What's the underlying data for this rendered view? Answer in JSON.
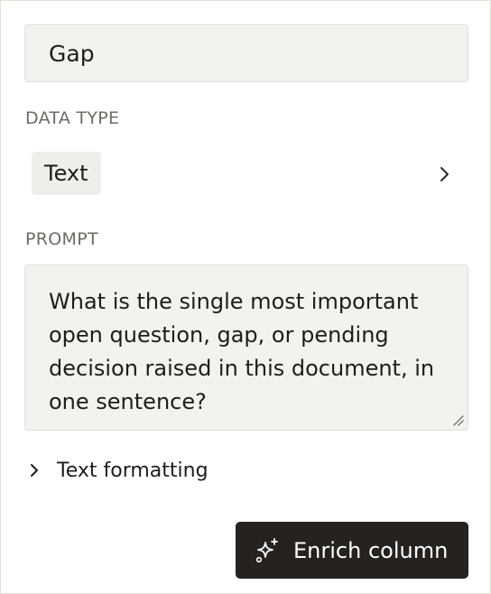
{
  "column": {
    "name_value": "Gap"
  },
  "data_type": {
    "label": "DATA TYPE",
    "selected": "Text"
  },
  "prompt": {
    "label": "PROMPT",
    "value": "What is the single most important open question, gap, or pending decision raised in this document, in one sentence?"
  },
  "formatting": {
    "label": "Text formatting"
  },
  "actions": {
    "enrich_label": "Enrich column"
  },
  "icons": {
    "type_chevron": "chevron-right-icon",
    "formatting_chevron": "chevron-right-icon",
    "enrich": "sparkles-icon",
    "resize": "resize-grip-icon"
  },
  "colors": {
    "field_background": "#f3f2ef",
    "primary_button": "#25221f",
    "muted_label": "#6f6b64"
  }
}
